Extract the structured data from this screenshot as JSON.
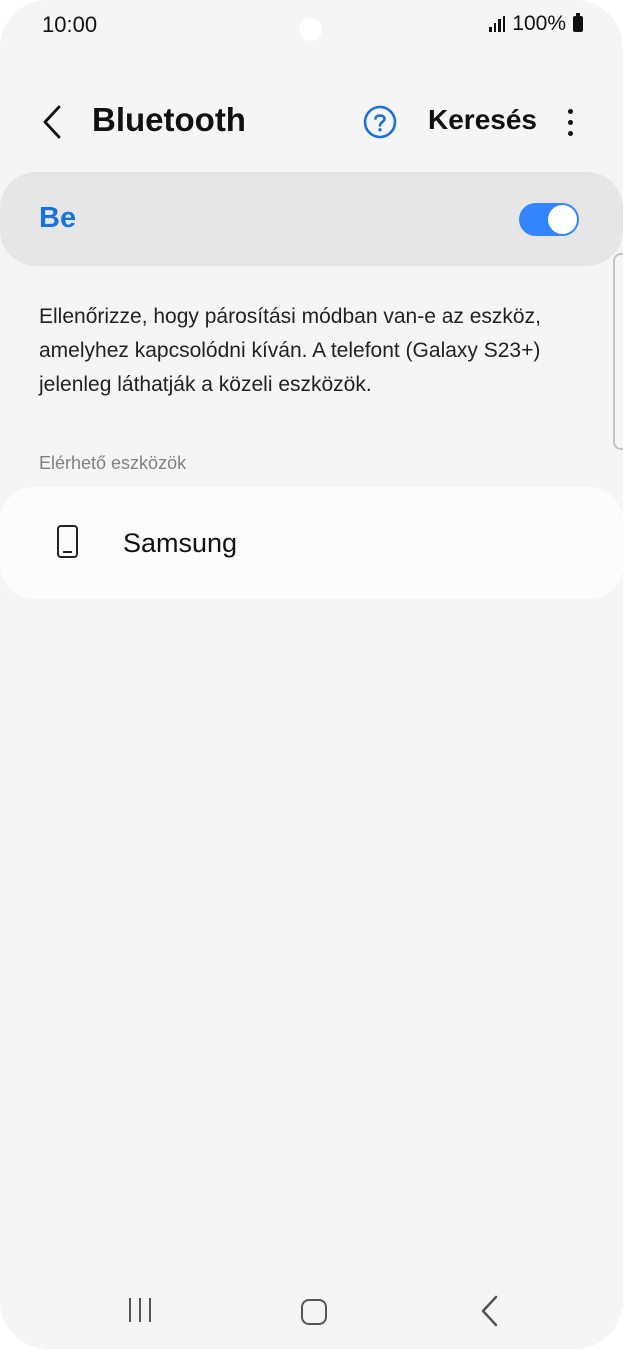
{
  "status_bar": {
    "time": "10:00",
    "battery": "100%"
  },
  "header": {
    "title": "Bluetooth",
    "search_label": "Keresés"
  },
  "toggle": {
    "label": "Be",
    "state": "on",
    "accent_color": "#3385ff"
  },
  "description": "Ellenőrizze, hogy párosítási módban van-e az eszköz, amelyhez kapcsolódni kíván. A telefont (Galaxy S23+) jelenleg láthatják a közeli eszközök.",
  "available_devices": {
    "header": "Elérhető eszközök",
    "items": [
      {
        "name": "Samsung",
        "icon": "smartphone-icon"
      }
    ]
  }
}
